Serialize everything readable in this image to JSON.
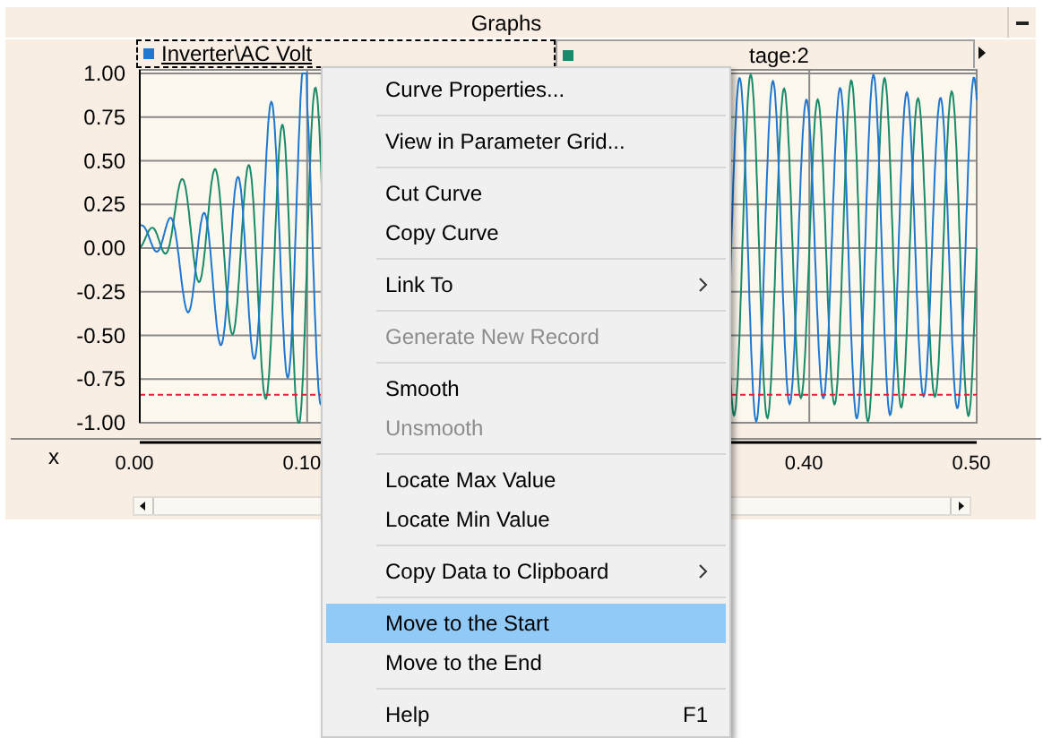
{
  "panel": {
    "title": "Graphs"
  },
  "legend": [
    {
      "label": "Inverter\\AC Volt",
      "color": "#1f77d0",
      "selected": true
    },
    {
      "label": "tage:2",
      "color": "#1a8a6a",
      "selected": false
    }
  ],
  "y_ticks": [
    "1.00",
    "0.75",
    "0.50",
    "0.25",
    "0.00",
    "-0.25",
    "-0.50",
    "-0.75",
    "-1.00"
  ],
  "x_axis": {
    "label": "x",
    "ticks": [
      "0.00",
      "0.10",
      "0.40",
      "0.50"
    ]
  },
  "context_menu": [
    {
      "kind": "item",
      "label": "Curve Properties...",
      "disabled": false,
      "submenu": false,
      "selected": false
    },
    {
      "kind": "separator"
    },
    {
      "kind": "item",
      "label": "View in Parameter Grid...",
      "disabled": false,
      "submenu": false,
      "selected": false
    },
    {
      "kind": "separator"
    },
    {
      "kind": "item",
      "label": "Cut Curve",
      "disabled": false,
      "submenu": false,
      "selected": false
    },
    {
      "kind": "item",
      "label": "Copy Curve",
      "disabled": false,
      "submenu": false,
      "selected": false
    },
    {
      "kind": "separator"
    },
    {
      "kind": "item",
      "label": "Link To",
      "disabled": false,
      "submenu": true,
      "selected": false
    },
    {
      "kind": "separator"
    },
    {
      "kind": "item",
      "label": "Generate New Record",
      "disabled": true,
      "submenu": false,
      "selected": false
    },
    {
      "kind": "separator"
    },
    {
      "kind": "item",
      "label": "Smooth",
      "disabled": false,
      "submenu": false,
      "selected": false
    },
    {
      "kind": "item",
      "label": "Unsmooth",
      "disabled": true,
      "submenu": false,
      "selected": false
    },
    {
      "kind": "separator"
    },
    {
      "kind": "item",
      "label": "Locate Max Value",
      "disabled": false,
      "submenu": false,
      "selected": false
    },
    {
      "kind": "item",
      "label": "Locate Min Value",
      "disabled": false,
      "submenu": false,
      "selected": false
    },
    {
      "kind": "separator"
    },
    {
      "kind": "item",
      "label": "Copy Data to Clipboard",
      "disabled": false,
      "submenu": true,
      "selected": false
    },
    {
      "kind": "separator"
    },
    {
      "kind": "item",
      "label": "Move to the Start",
      "disabled": false,
      "submenu": false,
      "selected": true
    },
    {
      "kind": "item",
      "label": "Move to the End",
      "disabled": false,
      "submenu": false,
      "selected": false
    },
    {
      "kind": "separator"
    },
    {
      "kind": "item",
      "label": "Help",
      "shortcut": "F1",
      "disabled": false,
      "submenu": false,
      "selected": false
    }
  ]
}
